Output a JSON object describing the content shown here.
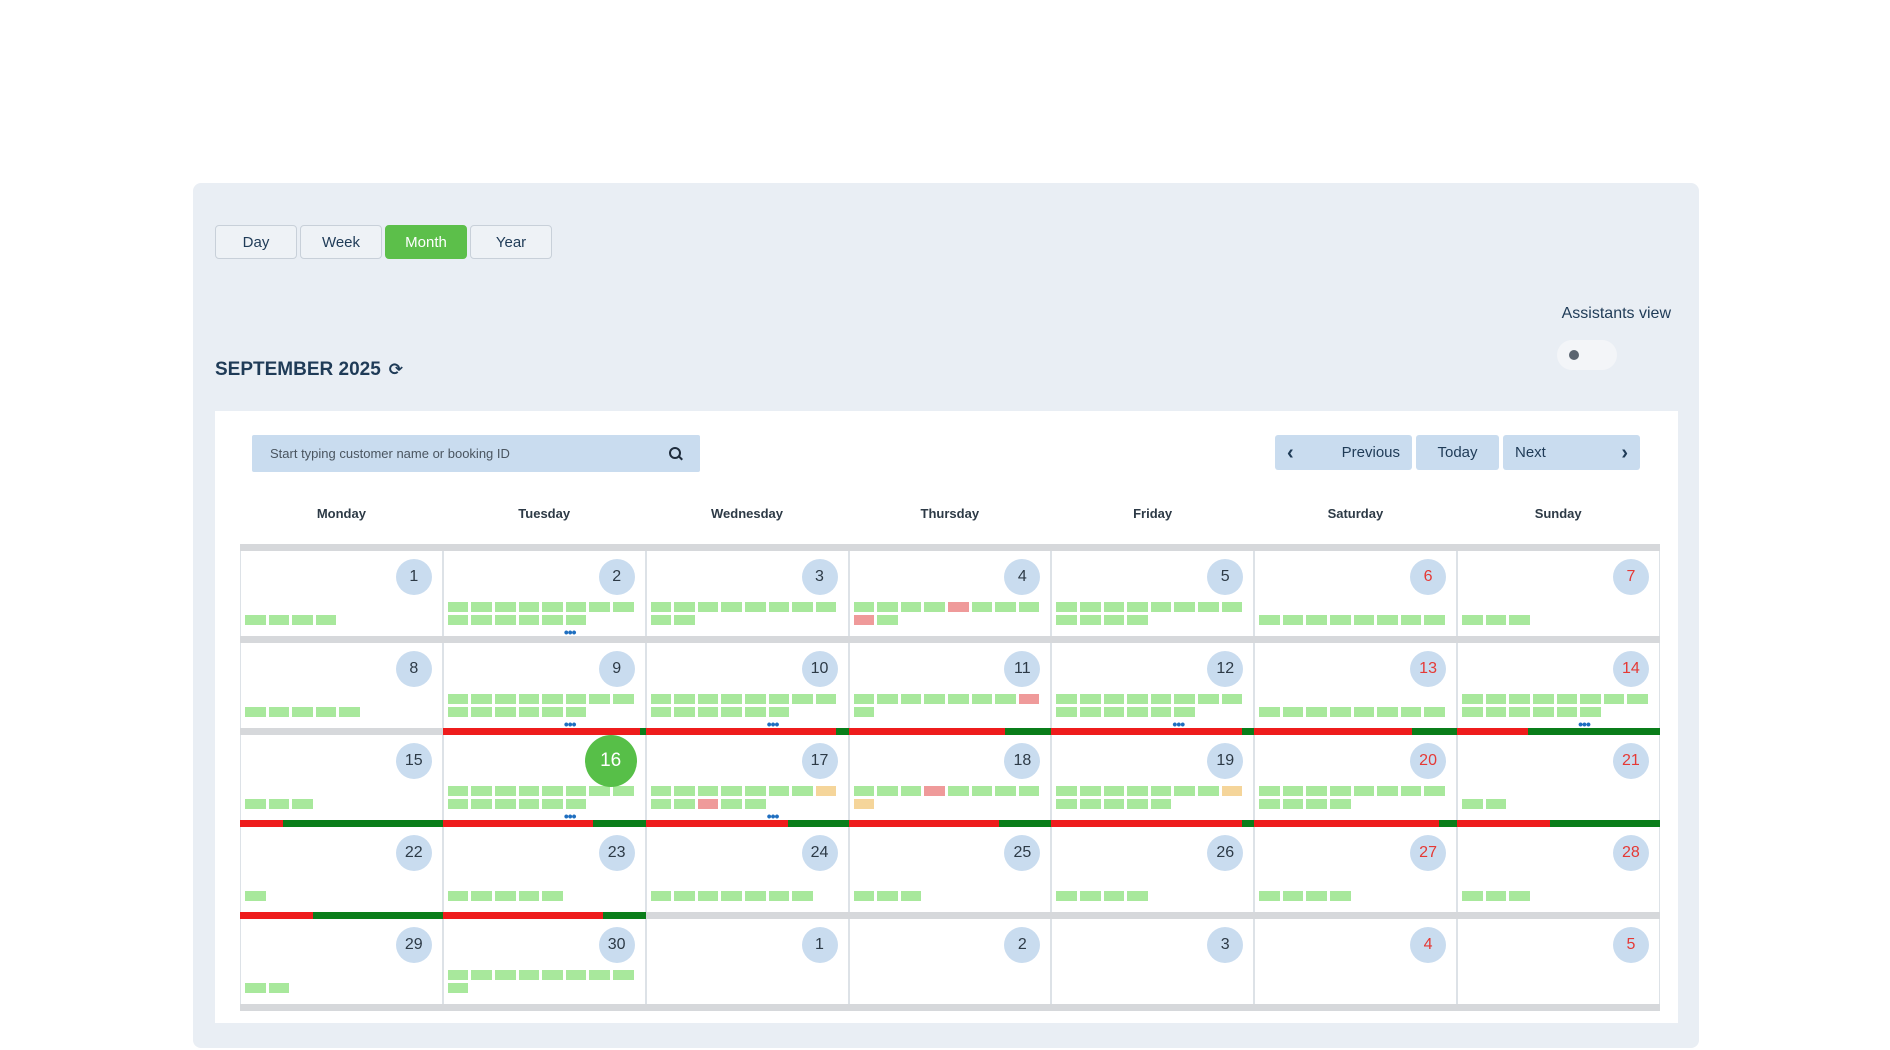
{
  "tabs": [
    {
      "label": "Day",
      "active": false
    },
    {
      "label": "Week",
      "active": false
    },
    {
      "label": "Month",
      "active": true
    },
    {
      "label": "Year",
      "active": false
    }
  ],
  "assistants_view": {
    "label": "Assistants view",
    "on": false
  },
  "header": {
    "title": "SEPTEMBER 2025",
    "refresh_icon": "refresh-icon"
  },
  "search": {
    "placeholder": "Start typing customer name or booking ID"
  },
  "nav": {
    "previous": "Previous",
    "today": "Today",
    "next": "Next"
  },
  "weekdays": [
    "Monday",
    "Tuesday",
    "Wednesday",
    "Thursday",
    "Friday",
    "Saturday",
    "Sunday"
  ],
  "colors": {
    "accent": "#5cbf4a",
    "slot_green": "#a8e89c",
    "slot_red": "#ef9a9a",
    "slot_orange": "#f5d59a",
    "weekend": "#e53935",
    "bar_red": "#ee1c1c",
    "bar_green": "#0a7d1a"
  },
  "weeks": [
    {
      "load_bar": null,
      "days": [
        {
          "n": "1",
          "weekend": false,
          "slots": "gggg",
          "more": false
        },
        {
          "n": "2",
          "weekend": false,
          "slots": "gggggggggggggg",
          "more": true
        },
        {
          "n": "3",
          "weekend": false,
          "slots": "gggggggggg",
          "more": false
        },
        {
          "n": "4",
          "weekend": false,
          "slots": "ggggrgggrg",
          "more": false
        },
        {
          "n": "5",
          "weekend": false,
          "slots": "gggggggggggg",
          "more": false
        },
        {
          "n": "6",
          "weekend": true,
          "slots": "gggggggg",
          "more": false
        },
        {
          "n": "7",
          "weekend": true,
          "slots": "ggg",
          "more": false
        }
      ]
    },
    {
      "load_bar": [
        null,
        0.97,
        0.94,
        0.77,
        0.94,
        0.78,
        0.35
      ],
      "days": [
        {
          "n": "8",
          "weekend": false,
          "slots": "ggggg",
          "more": false
        },
        {
          "n": "9",
          "weekend": false,
          "slots": "gggggggggggggg",
          "more": true
        },
        {
          "n": "10",
          "weekend": false,
          "slots": "gggggggggggggg",
          "more": true
        },
        {
          "n": "11",
          "weekend": false,
          "slots": "gggggggrg",
          "more": false
        },
        {
          "n": "12",
          "weekend": false,
          "slots": "gggggggggggggg",
          "more": true
        },
        {
          "n": "13",
          "weekend": true,
          "slots": "gggggggg",
          "more": false
        },
        {
          "n": "14",
          "weekend": true,
          "slots": "gggggggggggggg",
          "more": true
        }
      ]
    },
    {
      "load_bar": [
        0.21,
        0.74,
        0.7,
        0.74,
        0.94,
        0.91,
        0.46
      ],
      "days": [
        {
          "n": "15",
          "weekend": false,
          "slots": "ggg",
          "more": false
        },
        {
          "n": "16",
          "weekend": false,
          "slots": "gggggggggggggg",
          "more": true,
          "today": true
        },
        {
          "n": "17",
          "weekend": false,
          "slots": "gggggggoggrgg",
          "more": true
        },
        {
          "n": "18",
          "weekend": false,
          "slots": "gggrggggo",
          "more": false
        },
        {
          "n": "19",
          "weekend": false,
          "slots": "gggggggoggggg",
          "more": false
        },
        {
          "n": "20",
          "weekend": true,
          "slots": "gggggggggggg",
          "more": false
        },
        {
          "n": "21",
          "weekend": true,
          "slots": "gg",
          "more": false
        }
      ]
    },
    {
      "load_bar": [
        0.36,
        0.79,
        null,
        null,
        null,
        null,
        null
      ],
      "days": [
        {
          "n": "22",
          "weekend": false,
          "slots": "g",
          "more": false
        },
        {
          "n": "23",
          "weekend": false,
          "slots": "ggggg",
          "more": false
        },
        {
          "n": "24",
          "weekend": false,
          "slots": "ggggggg",
          "more": false
        },
        {
          "n": "25",
          "weekend": false,
          "slots": "ggg",
          "more": false
        },
        {
          "n": "26",
          "weekend": false,
          "slots": "gggg",
          "more": false
        },
        {
          "n": "27",
          "weekend": true,
          "slots": "gggg",
          "more": false
        },
        {
          "n": "28",
          "weekend": true,
          "slots": "ggg",
          "more": false
        }
      ]
    },
    {
      "load_bar": null,
      "days": [
        {
          "n": "29",
          "weekend": false,
          "slots": "gg",
          "more": false
        },
        {
          "n": "30",
          "weekend": false,
          "slots": "ggggggggg",
          "more": false
        },
        {
          "n": "1",
          "weekend": false,
          "slots": "",
          "more": false
        },
        {
          "n": "2",
          "weekend": false,
          "slots": "",
          "more": false
        },
        {
          "n": "3",
          "weekend": false,
          "slots": "",
          "more": false
        },
        {
          "n": "4",
          "weekend": true,
          "slots": "",
          "more": false
        },
        {
          "n": "5",
          "weekend": true,
          "slots": "",
          "more": false
        }
      ]
    }
  ]
}
